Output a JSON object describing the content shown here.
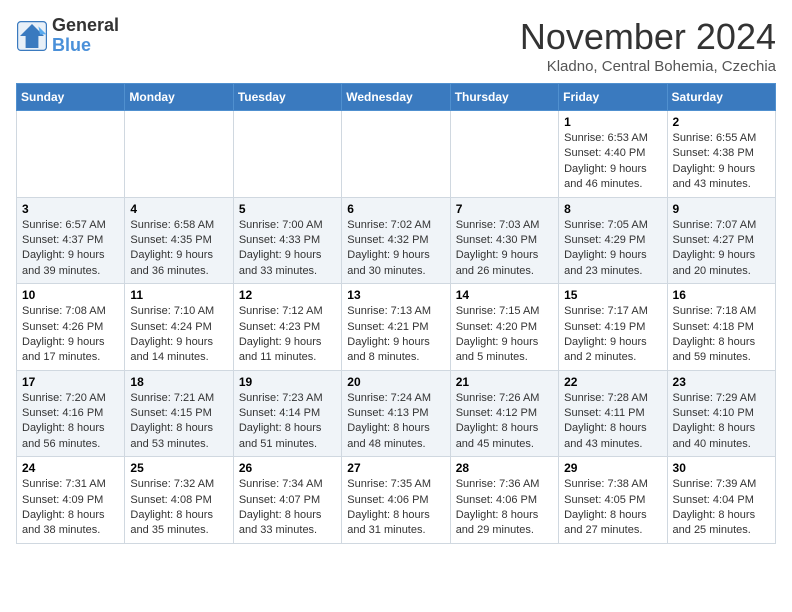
{
  "logo": {
    "line1": "General",
    "line2": "Blue"
  },
  "title": "November 2024",
  "location": "Kladno, Central Bohemia, Czechia",
  "days_of_week": [
    "Sunday",
    "Monday",
    "Tuesday",
    "Wednesday",
    "Thursday",
    "Friday",
    "Saturday"
  ],
  "weeks": [
    [
      {
        "day": "",
        "info": ""
      },
      {
        "day": "",
        "info": ""
      },
      {
        "day": "",
        "info": ""
      },
      {
        "day": "",
        "info": ""
      },
      {
        "day": "",
        "info": ""
      },
      {
        "day": "1",
        "info": "Sunrise: 6:53 AM\nSunset: 4:40 PM\nDaylight: 9 hours\nand 46 minutes."
      },
      {
        "day": "2",
        "info": "Sunrise: 6:55 AM\nSunset: 4:38 PM\nDaylight: 9 hours\nand 43 minutes."
      }
    ],
    [
      {
        "day": "3",
        "info": "Sunrise: 6:57 AM\nSunset: 4:37 PM\nDaylight: 9 hours\nand 39 minutes."
      },
      {
        "day": "4",
        "info": "Sunrise: 6:58 AM\nSunset: 4:35 PM\nDaylight: 9 hours\nand 36 minutes."
      },
      {
        "day": "5",
        "info": "Sunrise: 7:00 AM\nSunset: 4:33 PM\nDaylight: 9 hours\nand 33 minutes."
      },
      {
        "day": "6",
        "info": "Sunrise: 7:02 AM\nSunset: 4:32 PM\nDaylight: 9 hours\nand 30 minutes."
      },
      {
        "day": "7",
        "info": "Sunrise: 7:03 AM\nSunset: 4:30 PM\nDaylight: 9 hours\nand 26 minutes."
      },
      {
        "day": "8",
        "info": "Sunrise: 7:05 AM\nSunset: 4:29 PM\nDaylight: 9 hours\nand 23 minutes."
      },
      {
        "day": "9",
        "info": "Sunrise: 7:07 AM\nSunset: 4:27 PM\nDaylight: 9 hours\nand 20 minutes."
      }
    ],
    [
      {
        "day": "10",
        "info": "Sunrise: 7:08 AM\nSunset: 4:26 PM\nDaylight: 9 hours\nand 17 minutes."
      },
      {
        "day": "11",
        "info": "Sunrise: 7:10 AM\nSunset: 4:24 PM\nDaylight: 9 hours\nand 14 minutes."
      },
      {
        "day": "12",
        "info": "Sunrise: 7:12 AM\nSunset: 4:23 PM\nDaylight: 9 hours\nand 11 minutes."
      },
      {
        "day": "13",
        "info": "Sunrise: 7:13 AM\nSunset: 4:21 PM\nDaylight: 9 hours\nand 8 minutes."
      },
      {
        "day": "14",
        "info": "Sunrise: 7:15 AM\nSunset: 4:20 PM\nDaylight: 9 hours\nand 5 minutes."
      },
      {
        "day": "15",
        "info": "Sunrise: 7:17 AM\nSunset: 4:19 PM\nDaylight: 9 hours\nand 2 minutes."
      },
      {
        "day": "16",
        "info": "Sunrise: 7:18 AM\nSunset: 4:18 PM\nDaylight: 8 hours\nand 59 minutes."
      }
    ],
    [
      {
        "day": "17",
        "info": "Sunrise: 7:20 AM\nSunset: 4:16 PM\nDaylight: 8 hours\nand 56 minutes."
      },
      {
        "day": "18",
        "info": "Sunrise: 7:21 AM\nSunset: 4:15 PM\nDaylight: 8 hours\nand 53 minutes."
      },
      {
        "day": "19",
        "info": "Sunrise: 7:23 AM\nSunset: 4:14 PM\nDaylight: 8 hours\nand 51 minutes."
      },
      {
        "day": "20",
        "info": "Sunrise: 7:24 AM\nSunset: 4:13 PM\nDaylight: 8 hours\nand 48 minutes."
      },
      {
        "day": "21",
        "info": "Sunrise: 7:26 AM\nSunset: 4:12 PM\nDaylight: 8 hours\nand 45 minutes."
      },
      {
        "day": "22",
        "info": "Sunrise: 7:28 AM\nSunset: 4:11 PM\nDaylight: 8 hours\nand 43 minutes."
      },
      {
        "day": "23",
        "info": "Sunrise: 7:29 AM\nSunset: 4:10 PM\nDaylight: 8 hours\nand 40 minutes."
      }
    ],
    [
      {
        "day": "24",
        "info": "Sunrise: 7:31 AM\nSunset: 4:09 PM\nDaylight: 8 hours\nand 38 minutes."
      },
      {
        "day": "25",
        "info": "Sunrise: 7:32 AM\nSunset: 4:08 PM\nDaylight: 8 hours\nand 35 minutes."
      },
      {
        "day": "26",
        "info": "Sunrise: 7:34 AM\nSunset: 4:07 PM\nDaylight: 8 hours\nand 33 minutes."
      },
      {
        "day": "27",
        "info": "Sunrise: 7:35 AM\nSunset: 4:06 PM\nDaylight: 8 hours\nand 31 minutes."
      },
      {
        "day": "28",
        "info": "Sunrise: 7:36 AM\nSunset: 4:06 PM\nDaylight: 8 hours\nand 29 minutes."
      },
      {
        "day": "29",
        "info": "Sunrise: 7:38 AM\nSunset: 4:05 PM\nDaylight: 8 hours\nand 27 minutes."
      },
      {
        "day": "30",
        "info": "Sunrise: 7:39 AM\nSunset: 4:04 PM\nDaylight: 8 hours\nand 25 minutes."
      }
    ]
  ]
}
